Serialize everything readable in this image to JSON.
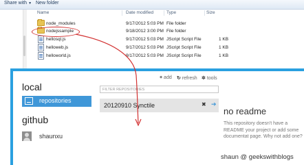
{
  "explorer": {
    "toolbar": {
      "share_with": "Share with",
      "new_folder": "New folder"
    },
    "columns": {
      "name": "Name",
      "date_modified": "Date modified",
      "type": "Type",
      "size": "Size"
    },
    "files": [
      {
        "name": "node_modules",
        "date": "9/17/2012 5:03 PM",
        "type": "File folder",
        "size": "",
        "icon": "folder-icon"
      },
      {
        "name": "nodejssample",
        "date": "9/18/2012 3:00 PM",
        "type": "File folder",
        "size": "",
        "icon": "folder-icon"
      },
      {
        "name": "hellosql.js",
        "date": "9/17/2012 5:03 PM",
        "type": "JScript Script File",
        "size": "1 KB",
        "icon": "js-file-icon"
      },
      {
        "name": "helloweb.js",
        "date": "9/17/2012 5:03 PM",
        "type": "JScript Script File",
        "size": "1 KB",
        "icon": "js-file-icon"
      },
      {
        "name": "helloworld.js",
        "date": "9/17/2012 5:03 PM",
        "type": "JScript Script File",
        "size": "1 KB",
        "icon": "js-file-icon"
      }
    ]
  },
  "github": {
    "local_title": "local",
    "repositories_label": "repositories",
    "github_title": "github",
    "account_name": "shaunxu",
    "actions": {
      "add": "add",
      "refresh": "refresh",
      "tools": "tools"
    },
    "filter_placeholder": "FILTER REPOSITORIES",
    "repo_name": "20120910 Synctile",
    "readme_title": "no readme",
    "readme_text": "This repository doesn't have a README your project or add some documentat page. Why not add one?"
  },
  "colors": {
    "accent": "#3f97d8",
    "window_border": "#2aa0e0",
    "annotation": "#d23030"
  },
  "credit": "shaun @ geekswithblogs"
}
